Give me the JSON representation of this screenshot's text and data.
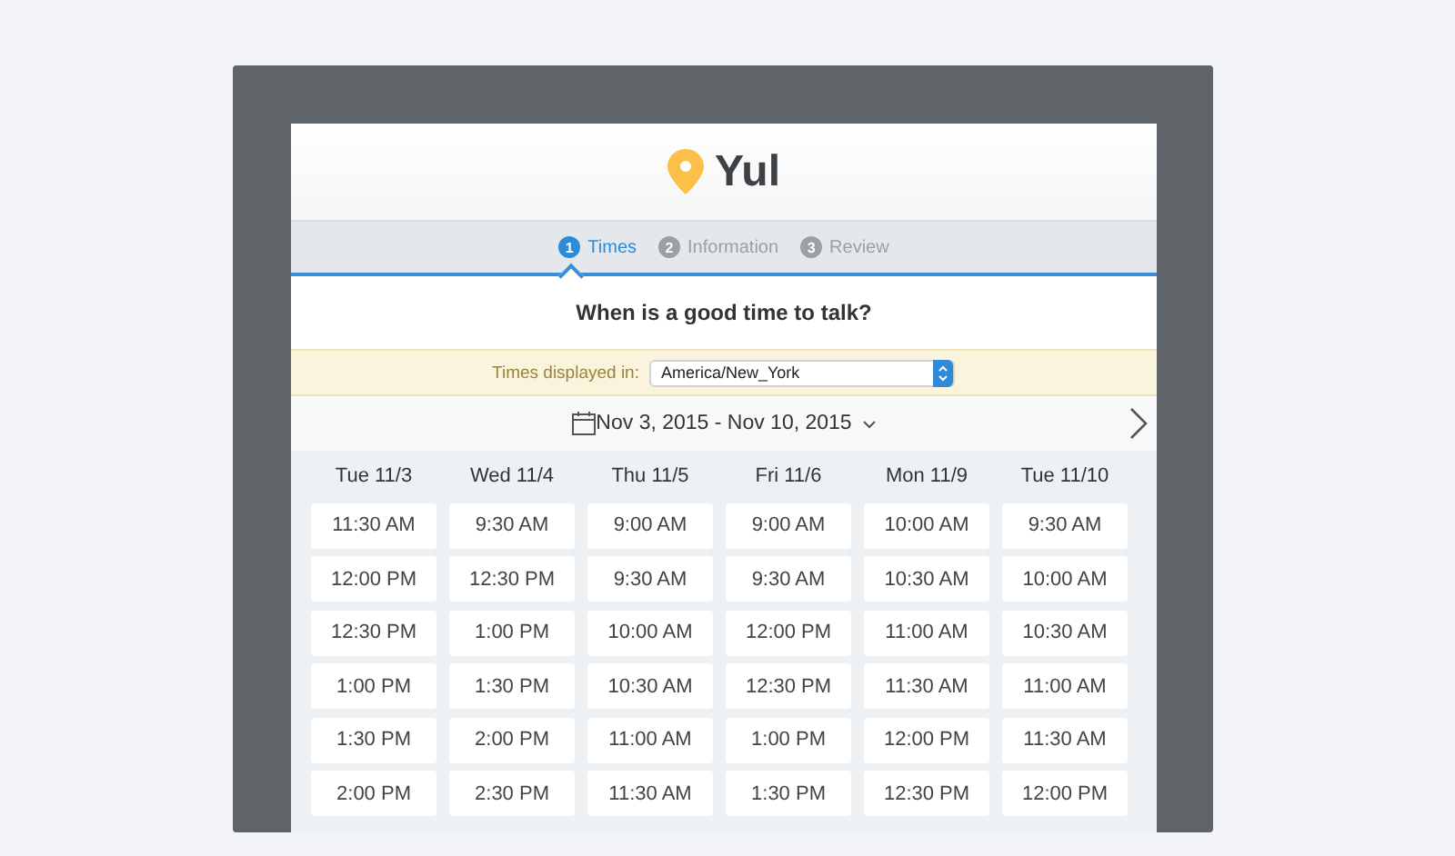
{
  "brand": {
    "name": "Yul"
  },
  "steps": [
    {
      "number": "1",
      "label": "Times",
      "selected": true
    },
    {
      "number": "2",
      "label": "Information",
      "selected": false
    },
    {
      "number": "3",
      "label": "Review",
      "selected": false
    }
  ],
  "question": "When is a good time to talk?",
  "timezone": {
    "label": "Times displayed in:",
    "value": "America/New_York"
  },
  "date_range": "Nov 3, 2015 - Nov 10, 2015",
  "days": [
    {
      "label": "Tue 11/3",
      "slots": [
        "11:30 AM",
        "12:00 PM",
        "12:30 PM",
        "1:00 PM",
        "1:30 PM",
        "2:00 PM"
      ]
    },
    {
      "label": "Wed 11/4",
      "slots": [
        "9:30 AM",
        "12:30 PM",
        "1:00 PM",
        "1:30 PM",
        "2:00 PM",
        "2:30 PM"
      ]
    },
    {
      "label": "Thu 11/5",
      "slots": [
        "9:00 AM",
        "9:30 AM",
        "10:00 AM",
        "10:30 AM",
        "11:00 AM",
        "11:30 AM"
      ]
    },
    {
      "label": "Fri 11/6",
      "slots": [
        "9:00 AM",
        "9:30 AM",
        "12:00 PM",
        "12:30 PM",
        "1:00 PM",
        "1:30 PM"
      ]
    },
    {
      "label": "Mon 11/9",
      "slots": [
        "10:00 AM",
        "10:30 AM",
        "11:00 AM",
        "11:30 AM",
        "12:00 PM",
        "12:30 PM"
      ]
    },
    {
      "label": "Tue 11/10",
      "slots": [
        "9:30 AM",
        "10:00 AM",
        "10:30 AM",
        "11:00 AM",
        "11:30 AM",
        "12:00 PM"
      ]
    }
  ]
}
